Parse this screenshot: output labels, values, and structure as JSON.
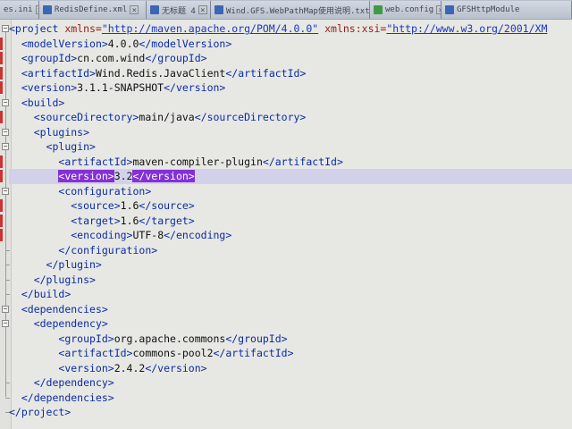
{
  "tabs": [
    {
      "label": "es.ini",
      "icon": "ini-file-icon"
    },
    {
      "label": "RedisDefine.xml",
      "icon": "xml-file-icon"
    },
    {
      "label": "无标题 4",
      "icon": "text-file-icon"
    },
    {
      "label": "Wind.GFS.WebPathMap使用说明.txt",
      "icon": "text-file-icon"
    },
    {
      "label": "web.config",
      "icon": "config-file-icon"
    },
    {
      "label": "GFSHttpModule",
      "icon": "code-file-icon"
    }
  ],
  "code_lines": [
    {
      "indent": "",
      "tag": "<project",
      "attrs": [
        {
          "name": " xmlns=",
          "value": "\"http://maven.apache.org/POM/4.0.0\""
        },
        {
          "name": " xmlns:xsi=",
          "value": "\"http://www.w3.org/2001/XM"
        }
      ]
    },
    {
      "indent": "  ",
      "open": "<modelVersion>",
      "text": "4.0.0",
      "close": "</modelVersion>"
    },
    {
      "indent": "  ",
      "open": "<groupId>",
      "text": "cn.com.wind",
      "close": "</groupId>"
    },
    {
      "indent": "  ",
      "open": "<artifactId>",
      "text": "Wind.Redis.JavaClient",
      "close": "</artifactId>"
    },
    {
      "indent": "  ",
      "open": "<version>",
      "text": "3.1.1-SNAPSHOT",
      "close": "</version>"
    },
    {
      "indent": "  ",
      "open": "<build>"
    },
    {
      "indent": "    ",
      "open": "<sourceDirectory>",
      "text": "main/java",
      "close": "</sourceDirectory>"
    },
    {
      "indent": "    ",
      "open": "<plugins>"
    },
    {
      "indent": "      ",
      "open": "<plugin>"
    },
    {
      "indent": "        ",
      "open": "<artifactId>",
      "text": "maven-compiler-plugin",
      "close": "</artifactId>"
    },
    {
      "indent": "        ",
      "open": "<version>",
      "text": "3.2",
      "close": "</version>",
      "selected": true
    },
    {
      "indent": "        ",
      "open": "<configuration>"
    },
    {
      "indent": "          ",
      "open": "<source>",
      "text": "1.6",
      "close": "</source>"
    },
    {
      "indent": "          ",
      "open": "<target>",
      "text": "1.6",
      "close": "</target>"
    },
    {
      "indent": "          ",
      "open": "<encoding>",
      "text": "UTF-8",
      "close": "</encoding>"
    },
    {
      "indent": "        ",
      "open": "</configuration>"
    },
    {
      "indent": "      ",
      "open": "</plugin>"
    },
    {
      "indent": "    ",
      "open": "</plugins>"
    },
    {
      "indent": "  ",
      "open": "</build>"
    },
    {
      "indent": "  ",
      "open": "<dependencies>"
    },
    {
      "indent": "    ",
      "open": "<dependency>"
    },
    {
      "indent": "        ",
      "open": "<groupId>",
      "text": "org.apache.commons",
      "close": "</groupId>"
    },
    {
      "indent": "        ",
      "open": "<artifactId>",
      "text": "commons-pool2",
      "close": "</artifactId>"
    },
    {
      "indent": "        ",
      "open": "<version>",
      "text": "2.4.2",
      "close": "</version>"
    },
    {
      "indent": "    ",
      "open": "</dependency>"
    },
    {
      "indent": "  ",
      "open": "</dependencies>"
    },
    {
      "indent": "",
      "open": "</project>"
    }
  ],
  "colors": {
    "tag": "#0a2aa8",
    "attribute": "#9b1a1a",
    "attribute_value": "#1a35c7",
    "selection": "#8430d8",
    "current_line": "#d3d0ea"
  }
}
